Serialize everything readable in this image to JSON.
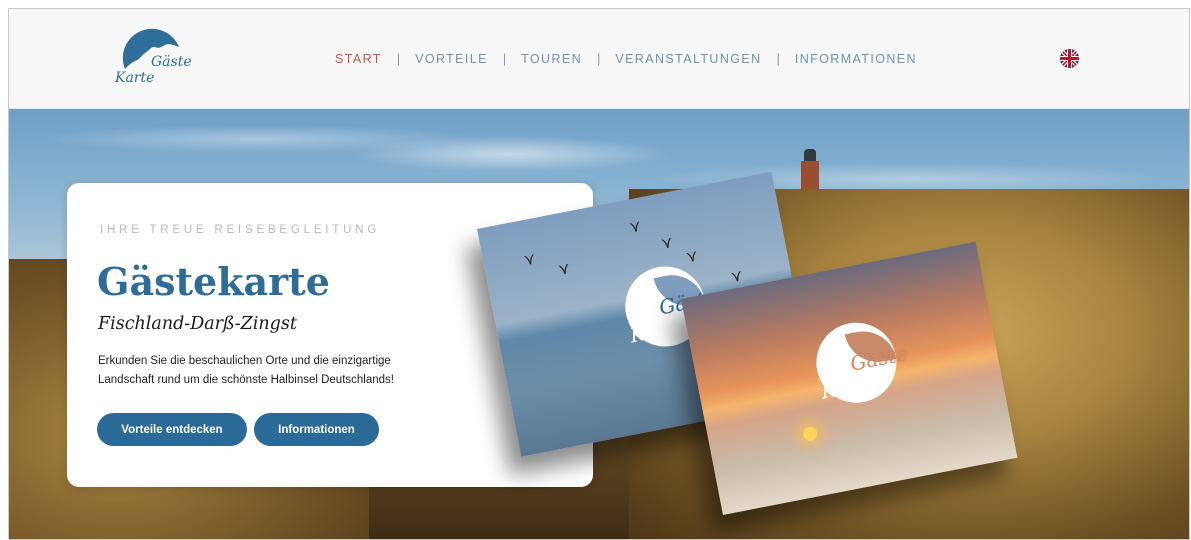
{
  "logo": {
    "line1": "Gäste",
    "line2": "Karte"
  },
  "nav": {
    "items": [
      {
        "label": "START",
        "active": true
      },
      {
        "label": "VORTEILE",
        "active": false
      },
      {
        "label": "TOUREN",
        "active": false
      },
      {
        "label": "VERANSTALTUNGEN",
        "active": false
      },
      {
        "label": "INFORMATIONEN",
        "active": false
      }
    ],
    "separator": "|",
    "active_color": "#c8574b",
    "color": "#6f93ad"
  },
  "language": {
    "icon": "uk-flag-icon"
  },
  "hero": {
    "tagline": "IHRE TREUE REISEBEGLEITUNG",
    "title": "Gästekarte",
    "subtitle": "Fischland-Darß-Zingst",
    "description": "Erkunden Sie die beschaulichen Orte und die einzigartige Landschaft rund um die schönste Halbinsel Deutschlands!",
    "primary_button": "Vorteile entdecken",
    "secondary_button": "Informationen",
    "accent_color": "#2b6a97"
  },
  "promo_cards": [
    {
      "logo_line1": "Gäste",
      "logo_line2": "Karte",
      "scene": "cranes-over-lagoon"
    },
    {
      "logo_line1": "Gäste",
      "logo_line2": "Karte",
      "scene": "sunset-over-dunes"
    }
  ]
}
